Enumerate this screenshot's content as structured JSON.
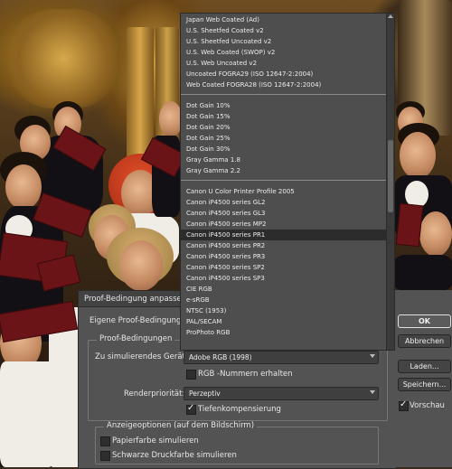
{
  "dialog": {
    "title": "Proof-Bedingung anpassen",
    "custom_label": "Eigene Proof-Bedingung:",
    "group_proof": "Proof-Bedingungen",
    "device_label": "Zu simulierendes Gerät:",
    "device_value": "Adobe RGB (1998)",
    "keep_numbers_label": "RGB -Nummern erhalten",
    "keep_numbers_checked": false,
    "intent_label": "Renderpriorität:",
    "intent_value": "Perzeptiv",
    "blackpoint_label": "Tiefenkompensierung",
    "blackpoint_checked": true,
    "group_display": "Anzeigeoptionen (auf dem Bildschirm)",
    "paper_label": "Papierfarbe simulieren",
    "paper_checked": false,
    "ink_label": "Schwarze Druckfarbe simulieren",
    "ink_checked": false
  },
  "buttons": {
    "ok": "OK",
    "cancel": "Abbrechen",
    "load": "Laden...",
    "save": "Speichern...",
    "preview_label": "Vorschau",
    "preview_checked": true
  },
  "dropdown": {
    "group1": [
      "Japan Web Coated (Ad)",
      "U.S. Sheetfed Coated v2",
      "U.S. Sheetfed Uncoated v2",
      "U.S. Web Coated (SWOP) v2",
      "U.S. Web Uncoated v2",
      "Uncoated FOGRA29 (ISO 12647-2:2004)",
      "Web Coated FOGRA28 (ISO 12647-2:2004)"
    ],
    "group2": [
      "Dot Gain 10%",
      "Dot Gain 15%",
      "Dot Gain 20%",
      "Dot Gain 25%",
      "Dot Gain 30%",
      "Gray Gamma 1.8",
      "Gray Gamma 2.2"
    ],
    "group3": [
      "Canon U Color Printer Profile 2005",
      "Canon iP4500 series GL2",
      "Canon iP4500 series GL3",
      "Canon iP4500 series MP2",
      "Canon iP4500 series PR1",
      "Canon iP4500 series PR2",
      "Canon iP4500 series PR3",
      "Canon iP4500 series SP2",
      "Canon iP4500 series SP3",
      "CIE RGB",
      "e-sRGB",
      "NTSC (1953)",
      "PAL/SECAM",
      "ProPhoto RGB"
    ],
    "selected": "Canon iP4500 series PR1"
  }
}
